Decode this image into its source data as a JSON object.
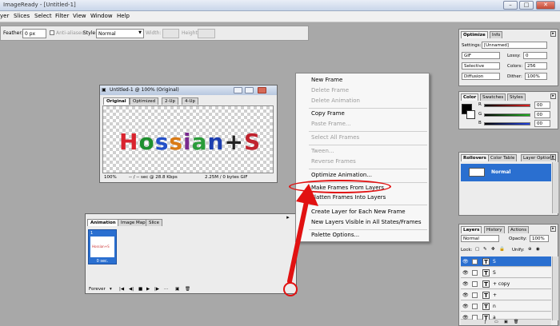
{
  "window": {
    "title": "ImageReady - [Untitled-1]",
    "controls": {
      "minimize": "–",
      "maximize": "□",
      "close": "✕"
    }
  },
  "menubar": [
    "yer",
    "Slices",
    "Select",
    "Filter",
    "View",
    "Window",
    "Help"
  ],
  "options_bar": {
    "feather_label": "Feather:",
    "feather_value": "0 px",
    "antialiased_label": "Anti-aliased",
    "style_label": "Style:",
    "style_value": "Normal",
    "width_label": "Width:",
    "height_label": "Height:"
  },
  "document": {
    "title": "Untitled-1 @ 100% (Original)",
    "tabs": [
      "Original",
      "Optimized",
      "2-Up",
      "4-Up"
    ],
    "active_tab": "Original",
    "artwork_text": [
      "H",
      "o",
      "s",
      "s",
      "i",
      "a",
      "n",
      "+",
      "S"
    ],
    "artwork_colors": [
      "#d9232e",
      "#1e8f2e",
      "#2450c8",
      "#d97a15",
      "#7a2a8f",
      "#2a9c3a",
      "#1e3fb0",
      "#222222",
      "#c0232e"
    ],
    "status": {
      "zoom": "100%",
      "speed": "-- / -- sec @ 28.8 Kbps",
      "size": "2.25M / 0 bytes GIF"
    }
  },
  "animation_palette": {
    "tabs": [
      "Animation",
      "Image Map",
      "Slice"
    ],
    "active_tab": "Animation",
    "frame_number": "1",
    "frame_thumb_text": "Hossian+S",
    "frame_delay": "0 sec.",
    "loop_value": "Forever"
  },
  "context_menu": {
    "items": [
      {
        "label": "New Frame",
        "enabled": true
      },
      {
        "label": "Delete Frame",
        "enabled": false
      },
      {
        "label": "Delete Animation",
        "enabled": false
      },
      {
        "separator": true
      },
      {
        "label": "Copy Frame",
        "enabled": true
      },
      {
        "label": "Paste Frame...",
        "enabled": false
      },
      {
        "separator": true
      },
      {
        "label": "Select All Frames",
        "enabled": false
      },
      {
        "separator": true
      },
      {
        "label": "Tween...",
        "enabled": false
      },
      {
        "label": "Reverse Frames",
        "enabled": false
      },
      {
        "separator": true
      },
      {
        "label": "Optimize Animation...",
        "enabled": true
      },
      {
        "separator": true
      },
      {
        "label": "Make Frames From Layers",
        "enabled": true,
        "highlighted": true
      },
      {
        "label": "Flatten Frames Into Layers",
        "enabled": true
      },
      {
        "separator": true
      },
      {
        "label": "Create Layer for Each New Frame",
        "enabled": true
      },
      {
        "label": "New Layers Visible in All States/Frames",
        "enabled": true,
        "checked": true
      },
      {
        "separator": true
      },
      {
        "label": "Palette Options...",
        "enabled": true
      }
    ]
  },
  "optimize_panel": {
    "tabs": [
      "Optimize",
      "Info"
    ],
    "settings_label": "Settings:",
    "settings_value": "[Unnamed]",
    "format": "GIF",
    "lossy_label": "Lossy:",
    "lossy_value": "0",
    "palette": "Selective",
    "colors_label": "Colors:",
    "colors_value": "256",
    "dither_method": "Diffusion",
    "dither_label": "Dither:",
    "dither_value": "100%"
  },
  "color_panel": {
    "tabs": [
      "Color",
      "Swatches",
      "Styles"
    ],
    "channels": [
      {
        "label": "R",
        "value": "00",
        "color": "#e02020"
      },
      {
        "label": "G",
        "value": "00",
        "color": "#20b020"
      },
      {
        "label": "B",
        "value": "00",
        "color": "#2040e0"
      }
    ]
  },
  "rollovers_panel": {
    "tabs": [
      "Rollovers",
      "Color Table",
      "Layer Options"
    ],
    "state_label": "Normal"
  },
  "layers_panel": {
    "tabs": [
      "Layers",
      "History",
      "Actions"
    ],
    "blend_mode": "Normal",
    "opacity_label": "Opacity:",
    "opacity_value": "100%",
    "lock_label": "Lock:",
    "unify_label": "Unify:",
    "layers": [
      {
        "name": "S",
        "selected": true
      },
      {
        "name": "S",
        "selected": false
      },
      {
        "name": "+ copy",
        "selected": false
      },
      {
        "name": "+",
        "selected": false
      },
      {
        "name": "n",
        "selected": false
      },
      {
        "name": "a",
        "selected": false
      }
    ]
  },
  "annotation_color": "#e11111"
}
